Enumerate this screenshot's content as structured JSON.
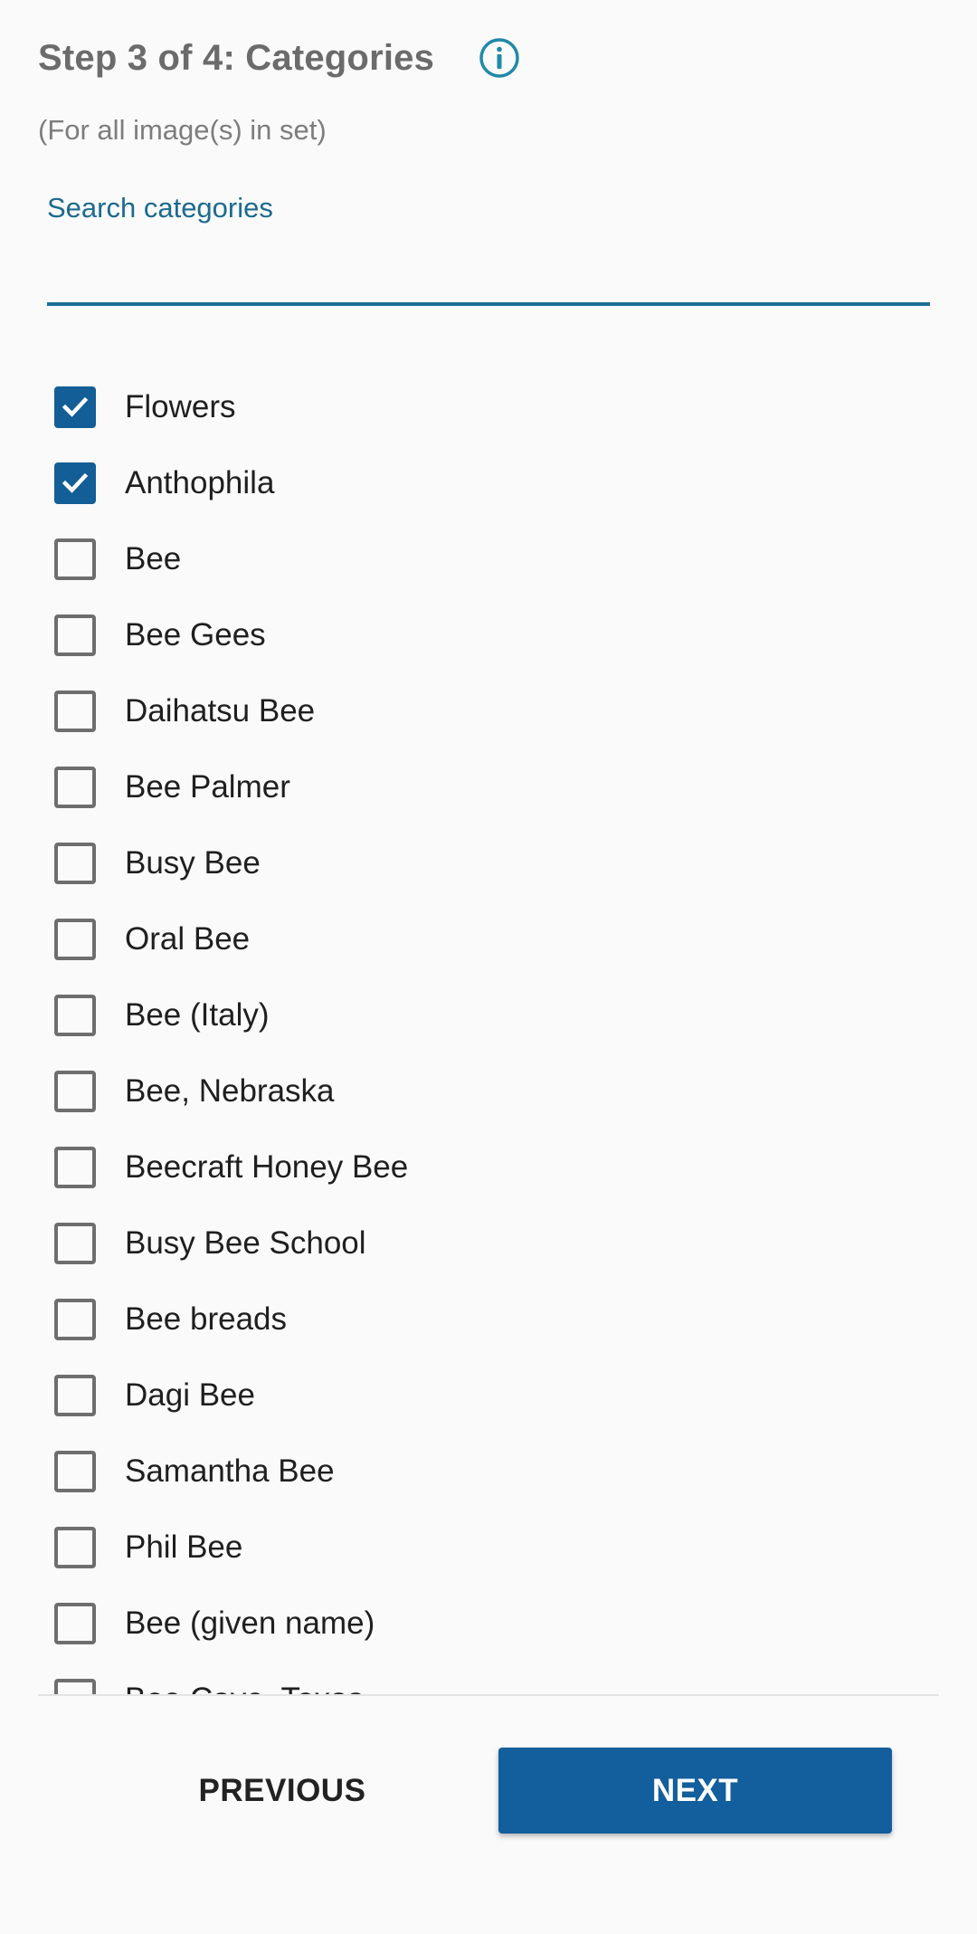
{
  "header": {
    "title": "Step 3 of 4: Categories",
    "subtitle": "(For all image(s) in set)",
    "info_icon": "info-circle-icon"
  },
  "search": {
    "label": "Search categories",
    "value": ""
  },
  "categories": [
    {
      "label": "Flowers",
      "checked": true
    },
    {
      "label": "Anthophila",
      "checked": true
    },
    {
      "label": "Bee",
      "checked": false
    },
    {
      "label": "Bee Gees",
      "checked": false
    },
    {
      "label": "Daihatsu Bee",
      "checked": false
    },
    {
      "label": "Bee Palmer",
      "checked": false
    },
    {
      "label": "Busy Bee",
      "checked": false
    },
    {
      "label": "Oral Bee",
      "checked": false
    },
    {
      "label": "Bee (Italy)",
      "checked": false
    },
    {
      "label": "Bee, Nebraska",
      "checked": false
    },
    {
      "label": "Beecraft Honey Bee",
      "checked": false
    },
    {
      "label": "Busy Bee School",
      "checked": false
    },
    {
      "label": "Bee breads",
      "checked": false
    },
    {
      "label": "Dagi Bee",
      "checked": false
    },
    {
      "label": "Samantha Bee",
      "checked": false
    },
    {
      "label": "Phil Bee",
      "checked": false
    },
    {
      "label": "Bee (given name)",
      "checked": false
    },
    {
      "label": "Bee Cave, Texas",
      "checked": false
    }
  ],
  "buttons": {
    "previous": "PREVIOUS",
    "next": "NEXT"
  },
  "colors": {
    "accent": "#135e96",
    "title": "#6b6b6b",
    "search_label": "#1c6a8f",
    "background": "#fafafa"
  }
}
